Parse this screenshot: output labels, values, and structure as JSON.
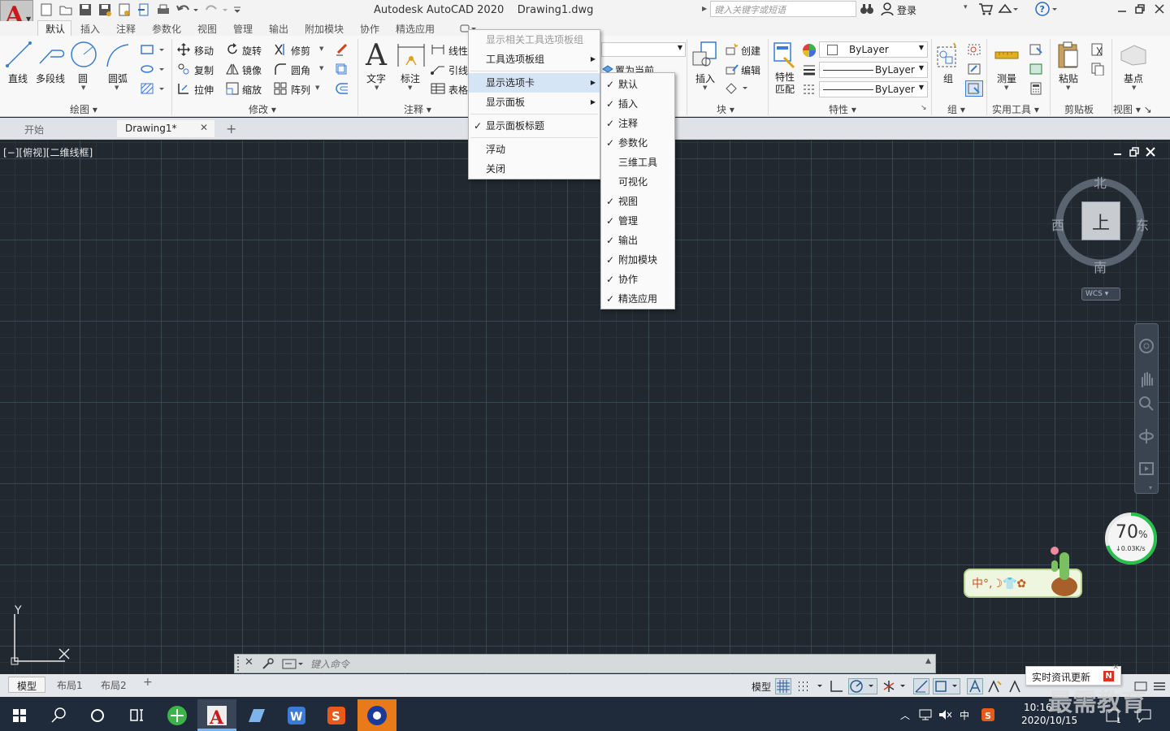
{
  "app": {
    "title": "Autodesk AutoCAD 2020",
    "document": "Drawing1.dwg",
    "logo_letter": "A"
  },
  "search": {
    "placeholder": "键入关键字或短语"
  },
  "user": {
    "login": "登录"
  },
  "ribbon_tabs": [
    "默认",
    "插入",
    "注释",
    "参数化",
    "视图",
    "管理",
    "输出",
    "附加模块",
    "协作",
    "精选应用"
  ],
  "panels": {
    "draw": {
      "label": "绘图",
      "tools": [
        "直线",
        "多段线",
        "圆",
        "圆弧"
      ]
    },
    "modify": {
      "label": "修改",
      "rows": [
        [
          "移动",
          "旋转",
          "修剪"
        ],
        [
          "复制",
          "镜像",
          "圆角"
        ],
        [
          "拉伸",
          "缩放",
          "阵列"
        ]
      ]
    },
    "annotation": {
      "label": "注释",
      "big": [
        "文字",
        "标注"
      ],
      "small": [
        "线性",
        "引线",
        "表格"
      ]
    },
    "layer": {
      "set_current": "置为当前"
    },
    "block": {
      "label": "块",
      "insert": "插入",
      "small": [
        "创建",
        "编辑"
      ]
    },
    "properties": {
      "label": "特性",
      "match": "特性\n匹配",
      "values": [
        "ByLayer",
        "ByLayer",
        "ByLayer"
      ]
    },
    "groups": {
      "label": "组",
      "btn": "组"
    },
    "utilities": {
      "label": "实用工具",
      "btn": "测量"
    },
    "clipboard": {
      "label": "剪贴板",
      "btn": "粘贴"
    },
    "view": {
      "label": "视图",
      "btn": "基点"
    }
  },
  "context_menu": {
    "items": [
      {
        "label": "显示相关工具选项板组",
        "disabled": true
      },
      {
        "label": "工具选项板组",
        "submenu": true
      },
      {
        "label": "显示选项卡",
        "submenu": true,
        "highlighted": true
      },
      {
        "label": "显示面板",
        "submenu": true
      },
      {
        "label": "显示面板标题",
        "checked": true
      },
      {
        "label": "浮动"
      },
      {
        "label": "关闭"
      }
    ]
  },
  "submenu": {
    "items": [
      {
        "label": "默认",
        "checked": true
      },
      {
        "label": "插入",
        "checked": true
      },
      {
        "label": "注释",
        "checked": true
      },
      {
        "label": "参数化",
        "checked": true
      },
      {
        "label": "三维工具",
        "checked": false
      },
      {
        "label": "可视化",
        "checked": false
      },
      {
        "label": "视图",
        "checked": true
      },
      {
        "label": "管理",
        "checked": true
      },
      {
        "label": "输出",
        "checked": true
      },
      {
        "label": "附加模块",
        "checked": true
      },
      {
        "label": "协作",
        "checked": true
      },
      {
        "label": "精选应用",
        "checked": true
      }
    ]
  },
  "doc_tabs": [
    "开始",
    "Drawing1*"
  ],
  "viewport": {
    "label": "[−][俯视][二维线框]"
  },
  "viewcube": {
    "north": "北",
    "south": "南",
    "east": "东",
    "west": "西",
    "face": "上",
    "wcs": "WCS"
  },
  "ucs": {
    "y": "Y"
  },
  "command": {
    "placeholder": "键入命令"
  },
  "layout_tabs": [
    "模型",
    "布局1",
    "布局2"
  ],
  "status": {
    "model": "模型"
  },
  "net_widget": {
    "percent": "70",
    "unit": "%",
    "speed": "↓0.03K/s"
  },
  "ime": {
    "text": "中°,☽👕✿"
  },
  "news": {
    "label": "实时资讯更新"
  },
  "watermark": "最需教育",
  "taskbar": {
    "time": "10:16",
    "date": "2020/10/15",
    "ime_lang": "中"
  },
  "colors": {
    "accent": "#3a7bd5",
    "menu_hl": "#cfe2f8",
    "bg": "#212830",
    "logo": "#c81a1a"
  }
}
